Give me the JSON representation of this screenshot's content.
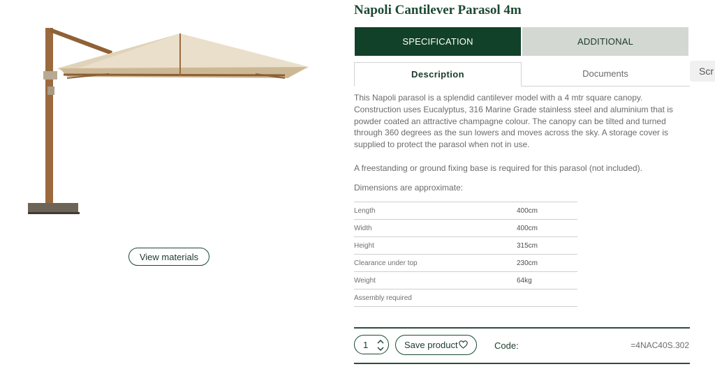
{
  "product": {
    "title": "Napoli Cantilever Parasol 4m",
    "image": {
      "alt": "Napoli cantilever parasol"
    },
    "view_materials_label": "View materials"
  },
  "tabs": {
    "main": [
      {
        "label": "SPECIFICATION",
        "active": true
      },
      {
        "label": "ADDITIONAL",
        "active": false
      }
    ],
    "sub": [
      {
        "label": "Description",
        "active": true
      },
      {
        "label": "Documents",
        "active": false
      }
    ]
  },
  "overlay": {
    "scroll_label": "Scr"
  },
  "description": {
    "paragraph1": "This Napoli parasol is a splendid cantilever model with a 4 mtr square canopy. Construction uses Eucalyptus, 316 Marine Grade stainless steel and aluminium that is powder coated an attractive champagne colour. The canopy can be tilted and turned through 360 degrees as the sun lowers and moves across the sky. A storage cover is supplied to protect the parasol when not in use.",
    "paragraph2": "A freestanding or ground fixing base is required for this parasol (not included).",
    "dimensions_label": "Dimensions are approximate:"
  },
  "specs": [
    {
      "name": "Length",
      "value": "400cm"
    },
    {
      "name": "Width",
      "value": "400cm"
    },
    {
      "name": "Height",
      "value": "315cm"
    },
    {
      "name": "Clearance under top",
      "value": "230cm"
    },
    {
      "name": "Weight",
      "value": "64kg"
    },
    {
      "name": "Assembly required",
      "value": ""
    }
  ],
  "purchase": {
    "quantity": "1",
    "save_label": "Save product",
    "code_label": "Code:",
    "code_value": "=4NAC40S.302"
  },
  "colors": {
    "brand_green": "#124129",
    "inactive_tab": "#d3d8d2",
    "canopy": "#e9dfcb",
    "wood": "#9a6a3e"
  },
  "icons": [
    "chevron-up-down-icon",
    "heart-icon"
  ]
}
